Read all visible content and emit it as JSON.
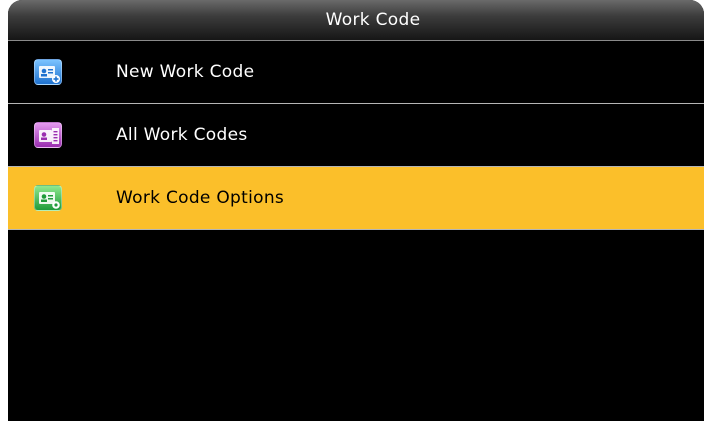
{
  "header": {
    "title": "Work Code"
  },
  "menu": {
    "items": [
      {
        "label": "New Work Code",
        "icon": "add-card-icon",
        "color": "#2f8ae4",
        "selected": false
      },
      {
        "label": "All Work Codes",
        "icon": "card-list-icon",
        "color": "#b64fcc",
        "selected": false
      },
      {
        "label": "Work Code Options",
        "icon": "card-settings-icon",
        "color": "#2fb24a",
        "selected": true
      }
    ]
  },
  "colors": {
    "background": "#000000",
    "selected_row": "#fbbf2a",
    "title_bar": "#3c3c3c"
  }
}
